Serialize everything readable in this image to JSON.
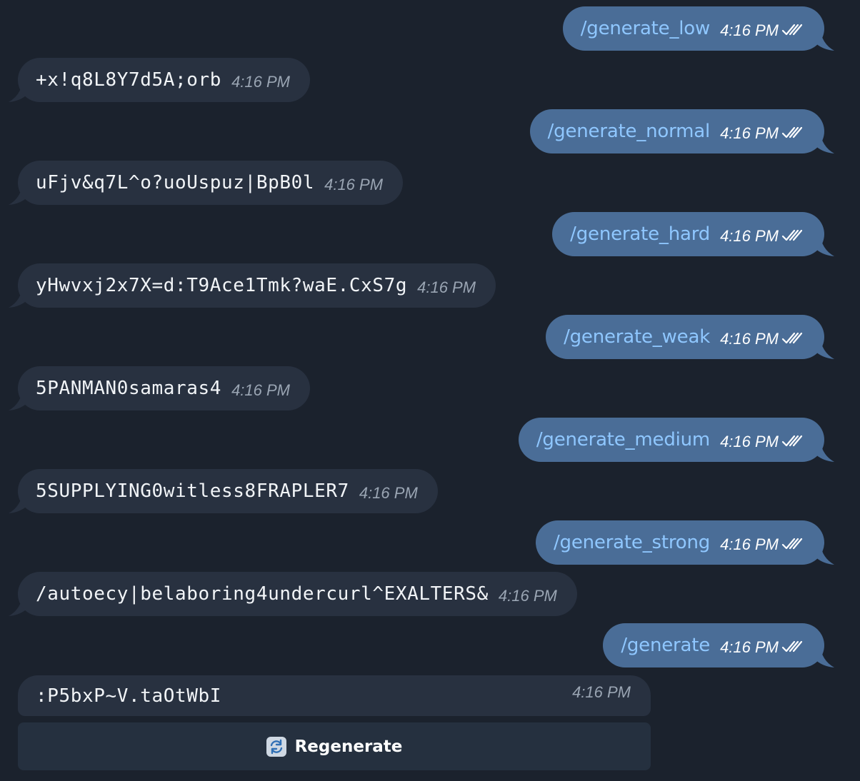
{
  "messages": [
    {
      "direction": "out",
      "text": "/generate_low",
      "time": "4:16 PM"
    },
    {
      "direction": "in",
      "text": "+x!q8L8Y7d5A;orb",
      "time": "4:16 PM"
    },
    {
      "direction": "out",
      "text": "/generate_normal",
      "time": "4:16 PM"
    },
    {
      "direction": "in",
      "text": "uFjv&q7L^o?uoUspuz|BpB0l",
      "time": "4:16 PM"
    },
    {
      "direction": "out",
      "text": "/generate_hard",
      "time": "4:16 PM"
    },
    {
      "direction": "in",
      "text": "yHwvxj2x7X=d:T9Ace1Tmk?waE.CxS7g",
      "time": "4:16 PM"
    },
    {
      "direction": "out",
      "text": "/generate_weak",
      "time": "4:16 PM"
    },
    {
      "direction": "in",
      "text": "5PANMAN0samaras4",
      "time": "4:16 PM"
    },
    {
      "direction": "out",
      "text": "/generate_medium",
      "time": "4:16 PM"
    },
    {
      "direction": "in",
      "text": "5SUPPLYING0witless8FRAPLER7",
      "time": "4:16 PM"
    },
    {
      "direction": "out",
      "text": "/generate_strong",
      "time": "4:16 PM"
    },
    {
      "direction": "in",
      "text": "/autoecy|belaboring4undercurl^EXALTERS&",
      "time": "4:16 PM"
    },
    {
      "direction": "out",
      "text": "/generate",
      "time": "4:16 PM"
    }
  ],
  "last_message": {
    "text": ":P5bxP~V.taOtWbI",
    "time": "4:16 PM"
  },
  "keyboard": {
    "regenerate_label": "Regenerate",
    "icon": "refresh-icon"
  },
  "colors": {
    "background": "#1b222d",
    "outgoing_bubble": "#4a6d97",
    "incoming_bubble": "#283140",
    "command_text": "#8fc7ff"
  }
}
